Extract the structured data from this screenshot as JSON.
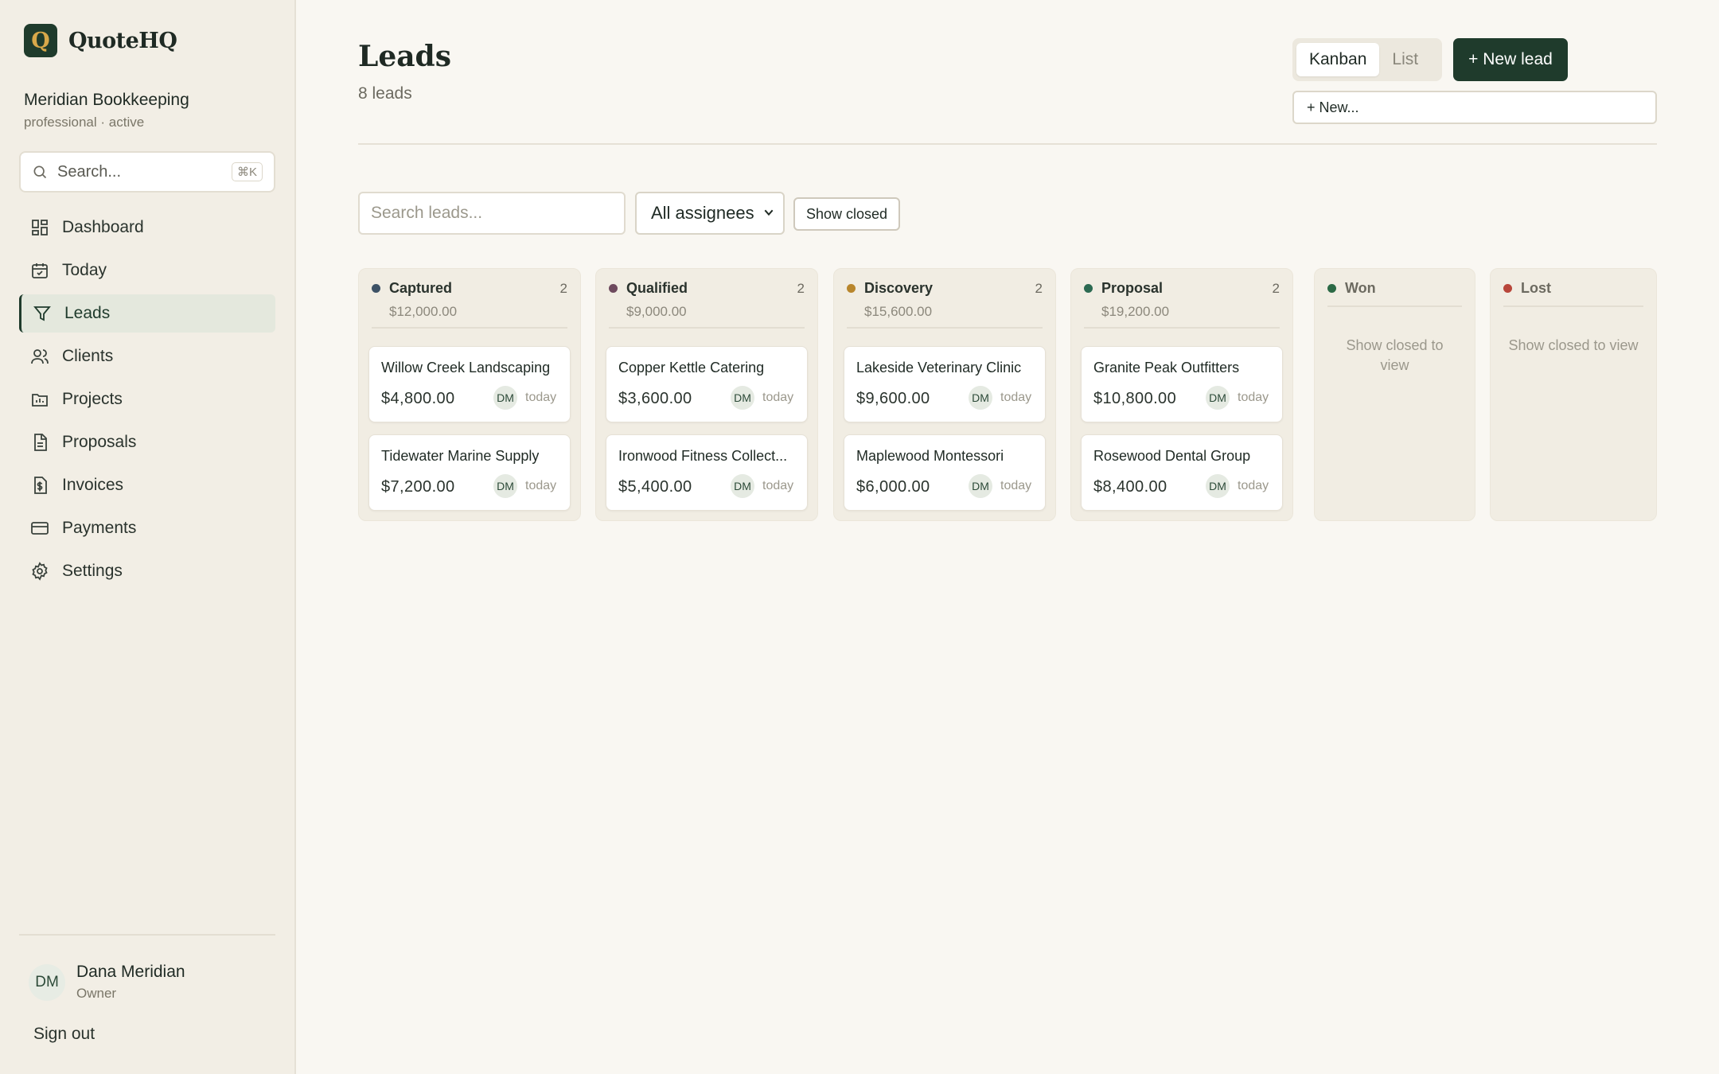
{
  "app": {
    "logo_letter": "Q",
    "name": "QuoteHQ"
  },
  "org": {
    "name": "Meridian Bookkeeping",
    "meta": "professional · active"
  },
  "sidebar": {
    "search_placeholder": "Search...",
    "search_shortcut": "⌘K",
    "items": [
      {
        "label": "Dashboard",
        "icon": "dashboard-icon"
      },
      {
        "label": "Today",
        "icon": "calendar-icon"
      },
      {
        "label": "Leads",
        "icon": "funnel-icon",
        "active": true
      },
      {
        "label": "Clients",
        "icon": "users-icon"
      },
      {
        "label": "Projects",
        "icon": "folder-icon"
      },
      {
        "label": "Proposals",
        "icon": "document-icon"
      },
      {
        "label": "Invoices",
        "icon": "invoice-icon"
      },
      {
        "label": "Payments",
        "icon": "credit-card-icon"
      },
      {
        "label": "Settings",
        "icon": "gear-icon"
      }
    ],
    "user": {
      "initials": "DM",
      "name": "Dana Meridian",
      "role": "Owner"
    },
    "sign_out": "Sign out"
  },
  "header": {
    "title": "Leads",
    "subtitle": "8 leads",
    "view_options": [
      "Kanban",
      "List"
    ],
    "active_view": "Kanban",
    "new_lead": "+ New lead",
    "new_menu": "+  New..."
  },
  "filters": {
    "search_placeholder": "Search leads...",
    "assignee": "All assignees",
    "show_closed": "Show closed"
  },
  "colors": {
    "accent": "#1f3b2c",
    "captured": "#3d5266",
    "qualified": "#6e4a5e",
    "discovery": "#b8862c",
    "proposal": "#2c6a52",
    "won": "#2c6a46",
    "lost": "#b8463a"
  },
  "board": {
    "columns": [
      {
        "name": "Captured",
        "count": "2",
        "total": "$12,000.00",
        "cards": [
          {
            "name": "Willow Creek Landscaping",
            "amount": "$4,800.00",
            "assignee": "DM",
            "when": "today"
          },
          {
            "name": "Tidewater Marine Supply",
            "amount": "$7,200.00",
            "assignee": "DM",
            "when": "today"
          }
        ]
      },
      {
        "name": "Qualified",
        "count": "2",
        "total": "$9,000.00",
        "cards": [
          {
            "name": "Copper Kettle Catering",
            "amount": "$3,600.00",
            "assignee": "DM",
            "when": "today"
          },
          {
            "name": "Ironwood Fitness Collect...",
            "amount": "$5,400.00",
            "assignee": "DM",
            "when": "today"
          }
        ]
      },
      {
        "name": "Discovery",
        "count": "2",
        "total": "$15,600.00",
        "cards": [
          {
            "name": "Lakeside Veterinary Clinic",
            "amount": "$9,600.00",
            "assignee": "DM",
            "when": "today"
          },
          {
            "name": "Maplewood Montessori",
            "amount": "$6,000.00",
            "assignee": "DM",
            "when": "today"
          }
        ]
      },
      {
        "name": "Proposal",
        "count": "2",
        "total": "$19,200.00",
        "cards": [
          {
            "name": "Granite Peak Outfitters",
            "amount": "$10,800.00",
            "assignee": "DM",
            "when": "today"
          },
          {
            "name": "Rosewood Dental Group",
            "amount": "$8,400.00",
            "assignee": "DM",
            "when": "today"
          }
        ]
      },
      {
        "name": "Won",
        "message": "Show closed to view"
      },
      {
        "name": "Lost",
        "message": "Show closed to view"
      }
    ]
  }
}
